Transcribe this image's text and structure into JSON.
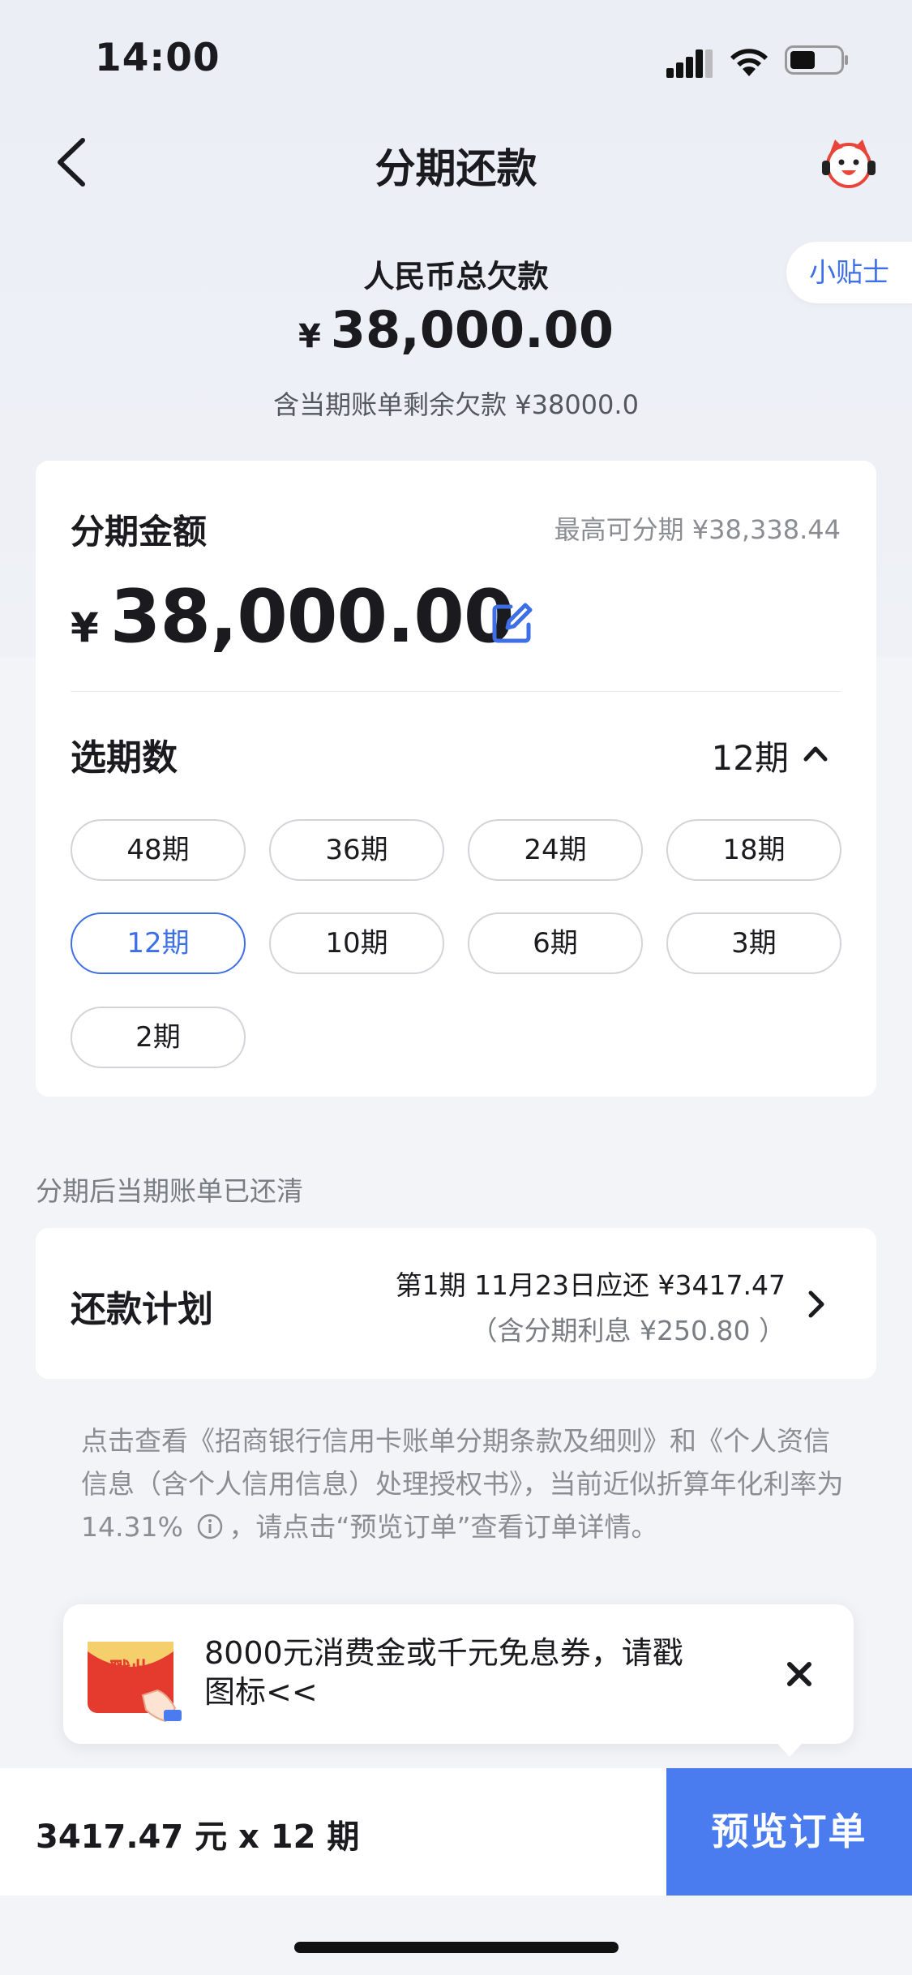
{
  "status_bar": {
    "time": "14:00"
  },
  "nav": {
    "title": "分期还款"
  },
  "summary": {
    "label": "人民币总欠款",
    "currency": "¥",
    "amount": "38,000.00",
    "sub": "含当期账单剩余欠款 ¥38000.0",
    "tips_label": "小贴士"
  },
  "installment": {
    "amount_label": "分期金额",
    "max_text": "最高可分期 ¥38,338.44",
    "currency": "¥",
    "amount": "38,000.00",
    "period_label": "选期数",
    "selected_period": "12期",
    "options": [
      "48期",
      "36期",
      "24期",
      "18期",
      "12期",
      "10期",
      "6期",
      "3期",
      "2期"
    ]
  },
  "note": "分期后当期账单已还清",
  "plan": {
    "label": "还款计划",
    "line1": "第1期 11月23日应还 ¥3417.47",
    "line2": "（含分期利息 ¥250.80 ）"
  },
  "terms": {
    "part1": "点击查看《招商银行信用卡账单分期条款及细则》和《个人资信信息（含个人信用信息）处理授权书》，当前近似折算年化利率为 14.31%",
    "part2": "，请点击“预览订单”查看订单详情。"
  },
  "promo": {
    "icon_text": "戳此",
    "text": "8000元消费金或千元免息券，请戳图标<<"
  },
  "bottom": {
    "summary": "3417.47 元 x 12 期",
    "button": "预览订单"
  },
  "colors": {
    "accent": "#3d6fe6",
    "button": "#4a7cf0"
  }
}
